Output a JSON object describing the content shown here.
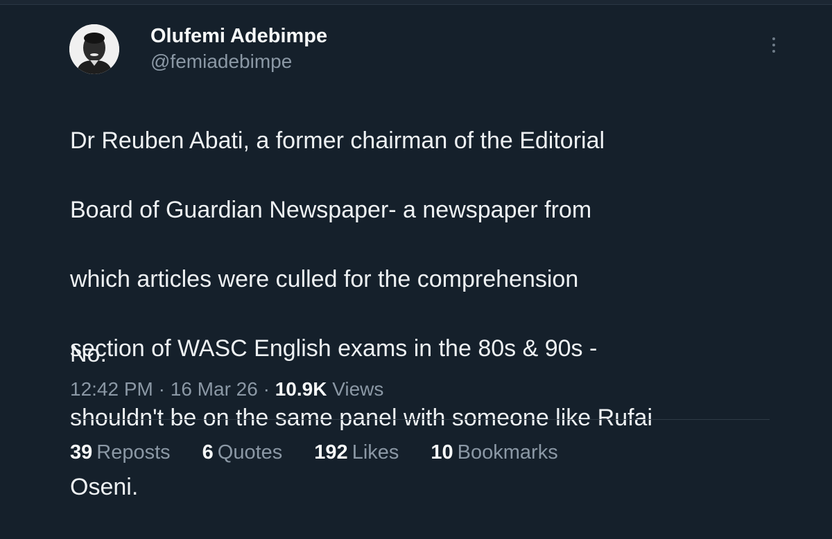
{
  "author": {
    "display_name": "Olufemi Adebimpe",
    "handle": "@femiadebimpe"
  },
  "tweet": {
    "lines": [
      "Dr Reuben Abati, a former chairman of the Editorial",
      "Board of Guardian Newspaper- a newspaper from",
      "which articles were culled for the comprehension",
      "section of WASC English exams in the 80s & 90s -",
      "shouldn't be on the same panel with someone like Rufai",
      "Oseni."
    ],
    "final_line": "No."
  },
  "meta": {
    "time": "12:42 PM",
    "sep1": "·",
    "date": "16 Mar 26",
    "sep2": "·",
    "views_count": "10.9K",
    "views_label": "Views"
  },
  "stats": [
    {
      "count": "39",
      "label": "Reposts"
    },
    {
      "count": "6",
      "label": "Quotes"
    },
    {
      "count": "192",
      "label": "Likes"
    },
    {
      "count": "10",
      "label": "Bookmarks"
    }
  ],
  "icons": {
    "more": "more-vertical-icon"
  },
  "colors": {
    "background": "#15202b",
    "text_primary": "#e7e9ea",
    "text_secondary": "#8b98a5"
  }
}
